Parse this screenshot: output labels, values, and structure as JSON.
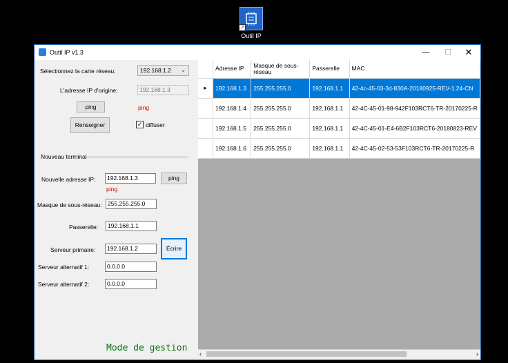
{
  "desktop": {
    "icon_label": "Outil IP"
  },
  "window": {
    "title": "Outil IP v1.3",
    "controls": {
      "minimize": "—",
      "maximize": "☐",
      "close": "✕"
    }
  },
  "left": {
    "select_label": "Sélectionnez la carte réseau:",
    "select_value": "192.168.1.2",
    "orig_label": "L'adresse IP d'origine:",
    "orig_value": "192.168.1.3",
    "ping1_button": "ping",
    "ping1_status": "ping",
    "renseigner_button": "Renseigner",
    "diffuser_label": "diffuser",
    "diffuser_checked": true,
    "group_title": "Nouveau terminal",
    "new_ip_label": "Nouvelle adresse IP:",
    "new_ip_value": "192.168.1.3",
    "ping2_button": "ping",
    "ping2_status": "ping",
    "mask_label": "Masque de sous-réseau:",
    "mask_value": "255.255.255.0",
    "gateway_label": "Passerelle:",
    "gateway_value": "192.168.1.1",
    "dns1_label": "Serveur primaire:",
    "dns1_value": "192.168.1.2",
    "write_button": "Écrire",
    "dns2_label": "Serveur alternatif 1:",
    "dns2_value": "0.0.0.0",
    "dns3_label": "Serveur alternatif 2:",
    "dns3_value": "0.0.0.0",
    "mode_text": "Mode de gestion"
  },
  "grid": {
    "headers": [
      "Adresse IP",
      "Masque de sous-réseau",
      "Passerelle",
      "MAC"
    ],
    "rows": [
      [
        "192.168.1.3",
        "255.255.255.0",
        "192.168.1.1",
        "42-4c-45-03-3d-830A-20180925-REV-1.24-CN"
      ],
      [
        "192.168.1.4",
        "255.255.255.0",
        "192.168.1.1",
        "42-4C-45-01-98-942F103RCT6-TR-20170225-R"
      ],
      [
        "192.168.1.5",
        "255.255.255.0",
        "192.168.1.1",
        "42-4C-45-01-E4-6B2F103RCT6-20180823-REV"
      ],
      [
        "192.168.1.6",
        "255.255.255.0",
        "192.168.1.1",
        "42-4C-45-02-53-53F103RCT6-TR-20170225-R"
      ]
    ],
    "selected_row": 0,
    "colors": {
      "selection": "#0078d7"
    }
  }
}
